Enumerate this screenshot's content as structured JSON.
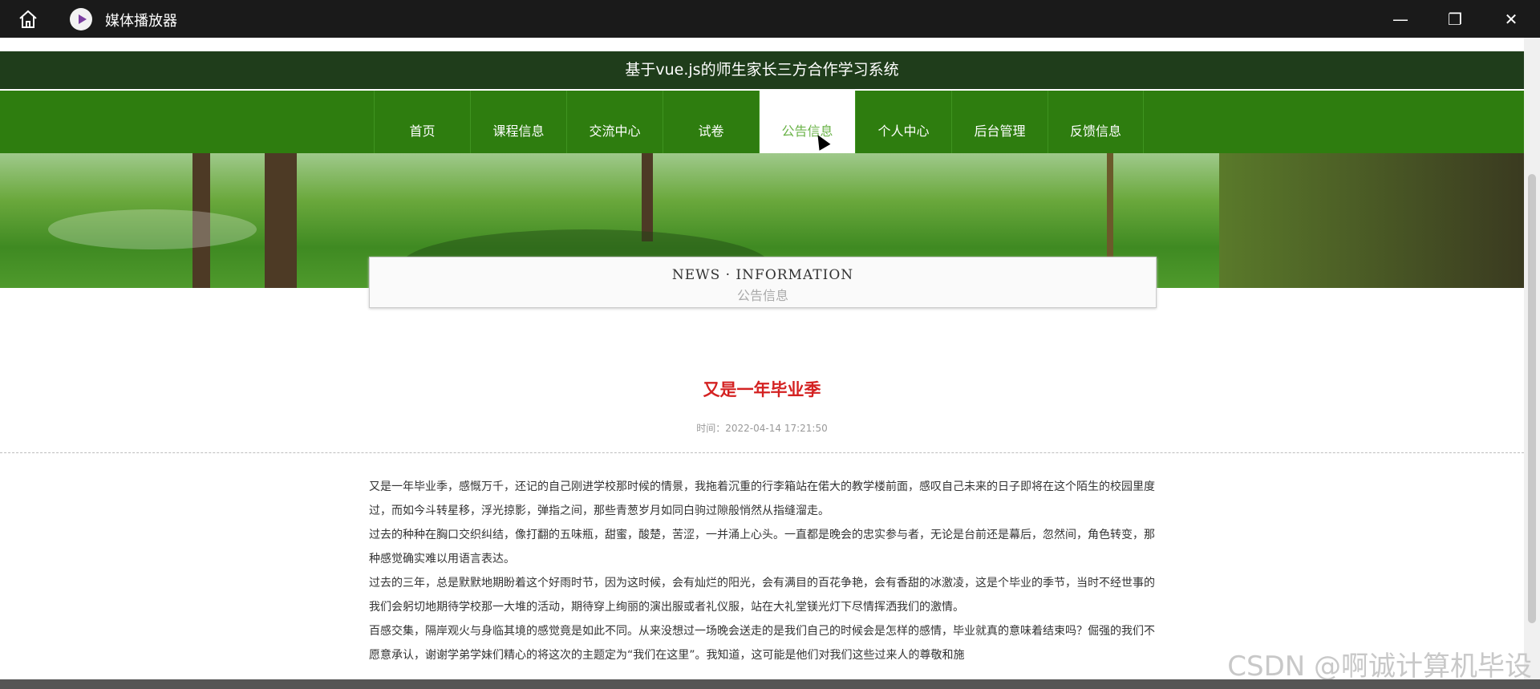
{
  "window": {
    "app_title": "媒体播放器",
    "minimize_glyph": "—",
    "restore_glyph": "❐",
    "close_glyph": "✕"
  },
  "site": {
    "title": "基于vue.js的师生家长三方合作学习系统"
  },
  "nav": {
    "items": [
      {
        "label": "首页"
      },
      {
        "label": "课程信息"
      },
      {
        "label": "交流中心"
      },
      {
        "label": "试卷"
      },
      {
        "label": "公告信息"
      },
      {
        "label": "个人中心"
      },
      {
        "label": "后台管理"
      },
      {
        "label": "反馈信息"
      }
    ],
    "active": "公告信息"
  },
  "section": {
    "en_title": "NEWS · INFORMATION",
    "cn_title": "公告信息"
  },
  "article": {
    "title": "又是一年毕业季",
    "meta": "时间：2022-04-14 17:21:50",
    "paragraphs": [
      "又是一年毕业季，感慨万千，还记的自己刚进学校那时候的情景，我拖着沉重的行李箱站在偌大的教学楼前面，感叹自己未来的日子即将在这个陌生的校园里度过，而如今斗转星移，浮光掠影，弹指之间，那些青葱岁月如同白驹过隙般悄然从指缝溜走。",
      "过去的种种在胸口交织纠结，像打翻的五味瓶，甜蜜，酸楚，苦涩，一并涌上心头。一直都是晚会的忠实参与者，无论是台前还是幕后，忽然间，角色转变，那种感觉确实难以用语言表达。",
      "过去的三年，总是默默地期盼着这个好雨时节，因为这时候，会有灿烂的阳光，会有满目的百花争艳，会有香甜的冰激凌，这是个毕业的季节，当时不经世事的我们会躬切地期待学校那一大堆的活动，期待穿上绚丽的演出服或者礼仪服，站在大礼堂镁光灯下尽情挥洒我们的激情。",
      "百感交集，隔岸观火与身临其境的感觉竟是如此不同。从来没想过一场晚会送走的是我们自己的时候会是怎样的感情，毕业就真的意味着结束吗？倔强的我们不愿意承认，谢谢学弟学妹们精心的将这次的主题定为“我们在这里”。我知道，这可能是他们对我们这些过来人的尊敬和施"
    ]
  },
  "watermark": "CSDN @啊诚计算机毕设",
  "colors": {
    "titlebar": "#1a1a1a",
    "site_header": "#1f3d1b",
    "nav": "#2e7d0f",
    "nav_active_text": "#6bb349",
    "article_title": "#d42222"
  },
  "icons": [
    "home-icon",
    "media-player-icon",
    "minimize-icon",
    "restore-icon",
    "close-icon",
    "mouse-cursor-icon"
  ]
}
